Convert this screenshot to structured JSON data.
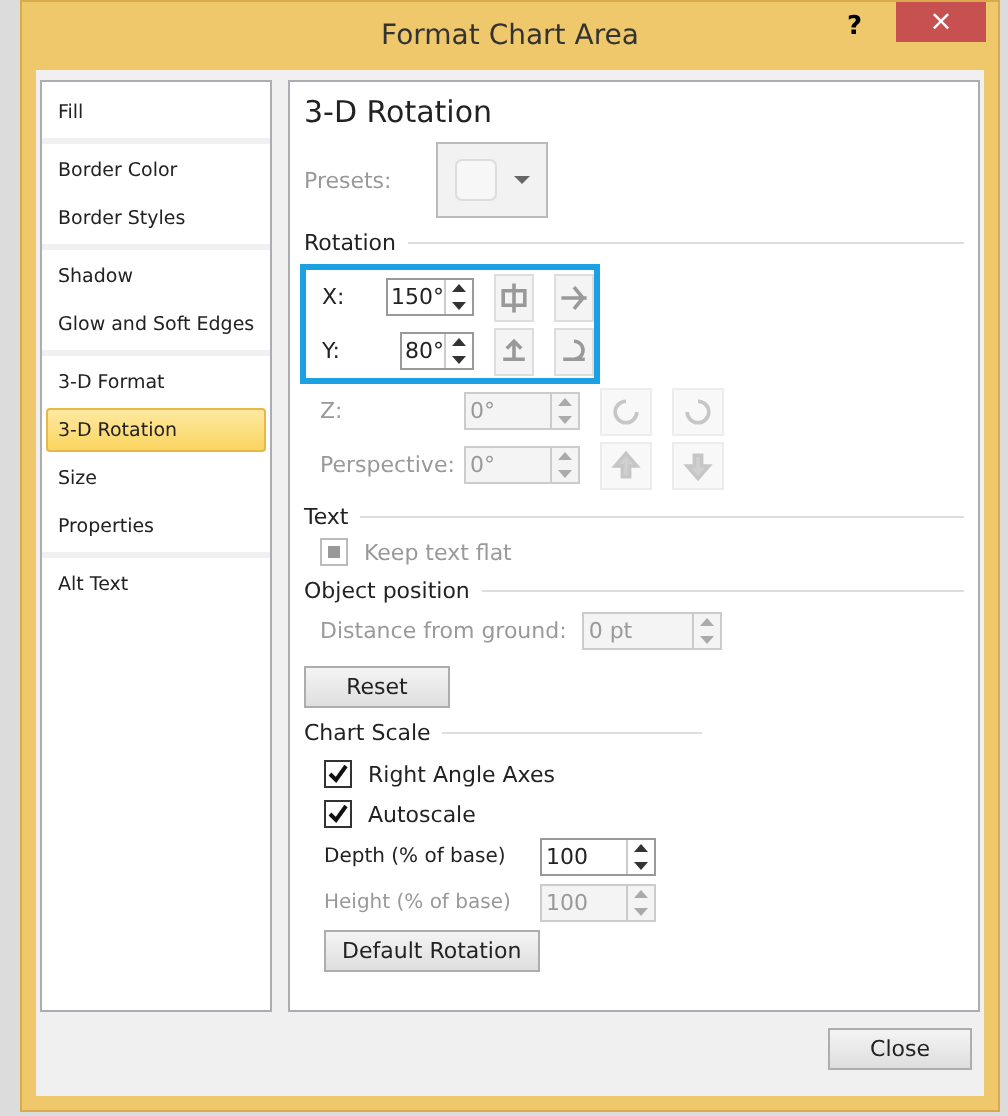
{
  "window": {
    "title": "Format Chart Area",
    "help": "?",
    "close": "×"
  },
  "sidebar": {
    "groups": [
      [
        {
          "label": "Fill",
          "selected": false
        }
      ],
      [
        {
          "label": "Border Color",
          "selected": false
        },
        {
          "label": "Border Styles",
          "selected": false
        }
      ],
      [
        {
          "label": "Shadow",
          "selected": false
        },
        {
          "label": "Glow and Soft Edges",
          "selected": false
        }
      ],
      [
        {
          "label": "3-D Format",
          "selected": false
        },
        {
          "label": "3-D Rotation",
          "selected": true
        },
        {
          "label": "Size",
          "selected": false
        },
        {
          "label": "Properties",
          "selected": false
        }
      ],
      [
        {
          "label": "Alt Text",
          "selected": false
        }
      ]
    ]
  },
  "panel": {
    "title": "3-D Rotation",
    "presets_label": "Presets:",
    "rotation": {
      "heading": "Rotation",
      "rows": [
        {
          "label": "X:",
          "value": "150°",
          "disabled": false,
          "highlighted": true
        },
        {
          "label": "Y:",
          "value": "80°",
          "disabled": false,
          "highlighted": true
        },
        {
          "label": "Z:",
          "value": "0°",
          "disabled": true,
          "highlighted": false
        },
        {
          "label": "Perspective:",
          "value": "0°",
          "disabled": true,
          "highlighted": false
        }
      ]
    },
    "text": {
      "heading": "Text",
      "keep_flat": {
        "label": "Keep text flat",
        "checked": true,
        "disabled": true
      }
    },
    "object_position": {
      "heading": "Object position",
      "distance": {
        "label": "Distance from ground:",
        "value": "0 pt",
        "disabled": true
      },
      "reset": "Reset"
    },
    "chart_scale": {
      "heading": "Chart Scale",
      "checks": [
        {
          "label": "Right Angle Axes",
          "checked": true
        },
        {
          "label": "Autoscale",
          "checked": true
        }
      ],
      "fields": [
        {
          "label": "Depth (% of base)",
          "value": "100",
          "disabled": false
        },
        {
          "label": "Height (% of base)",
          "value": "100",
          "disabled": true
        }
      ],
      "default_rotation": "Default Rotation"
    }
  },
  "buttons": [
    "Close"
  ]
}
